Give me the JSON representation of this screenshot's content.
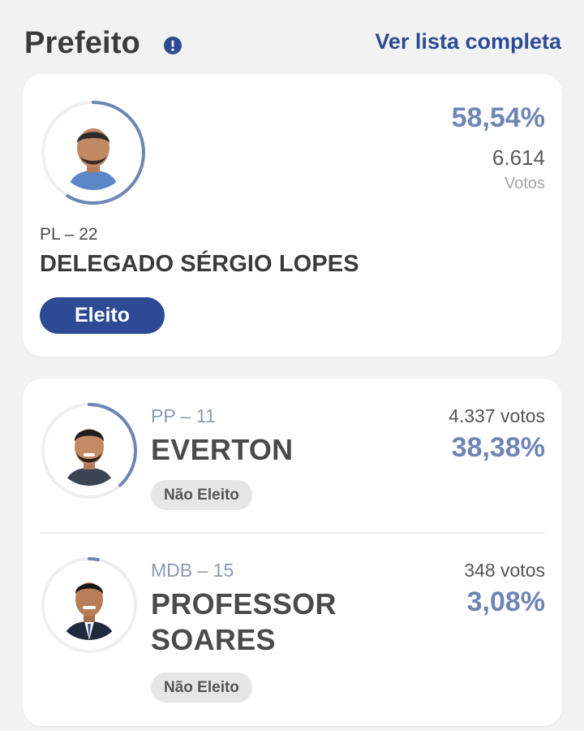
{
  "header": {
    "title": "Prefeito",
    "info_icon": "info-icon",
    "link_label": "Ver lista completa"
  },
  "colors": {
    "accent": "#2d4b94",
    "percent": "#6d86b5",
    "ring": "#6d86b5",
    "ring_track": "#efefef"
  },
  "winner": {
    "percent": "58,54%",
    "percent_value": 58.54,
    "votes": "6.614",
    "votes_label": "Votos",
    "party": "PL – 22",
    "name": "DELEGADO SÉRGIO LOPES",
    "status": "Eleito"
  },
  "candidates": [
    {
      "party": "PP – 11",
      "name": "EVERTON",
      "votes": "4.337 votos",
      "percent": "38,38%",
      "percent_value": 38.38,
      "status": "Não Eleito"
    },
    {
      "party": "MDB – 15",
      "name_line1": "PROFESSOR",
      "name_line2": "SOARES",
      "votes": "348 votos",
      "percent": "3,08%",
      "percent_value": 3.08,
      "status": "Não Eleito"
    }
  ]
}
